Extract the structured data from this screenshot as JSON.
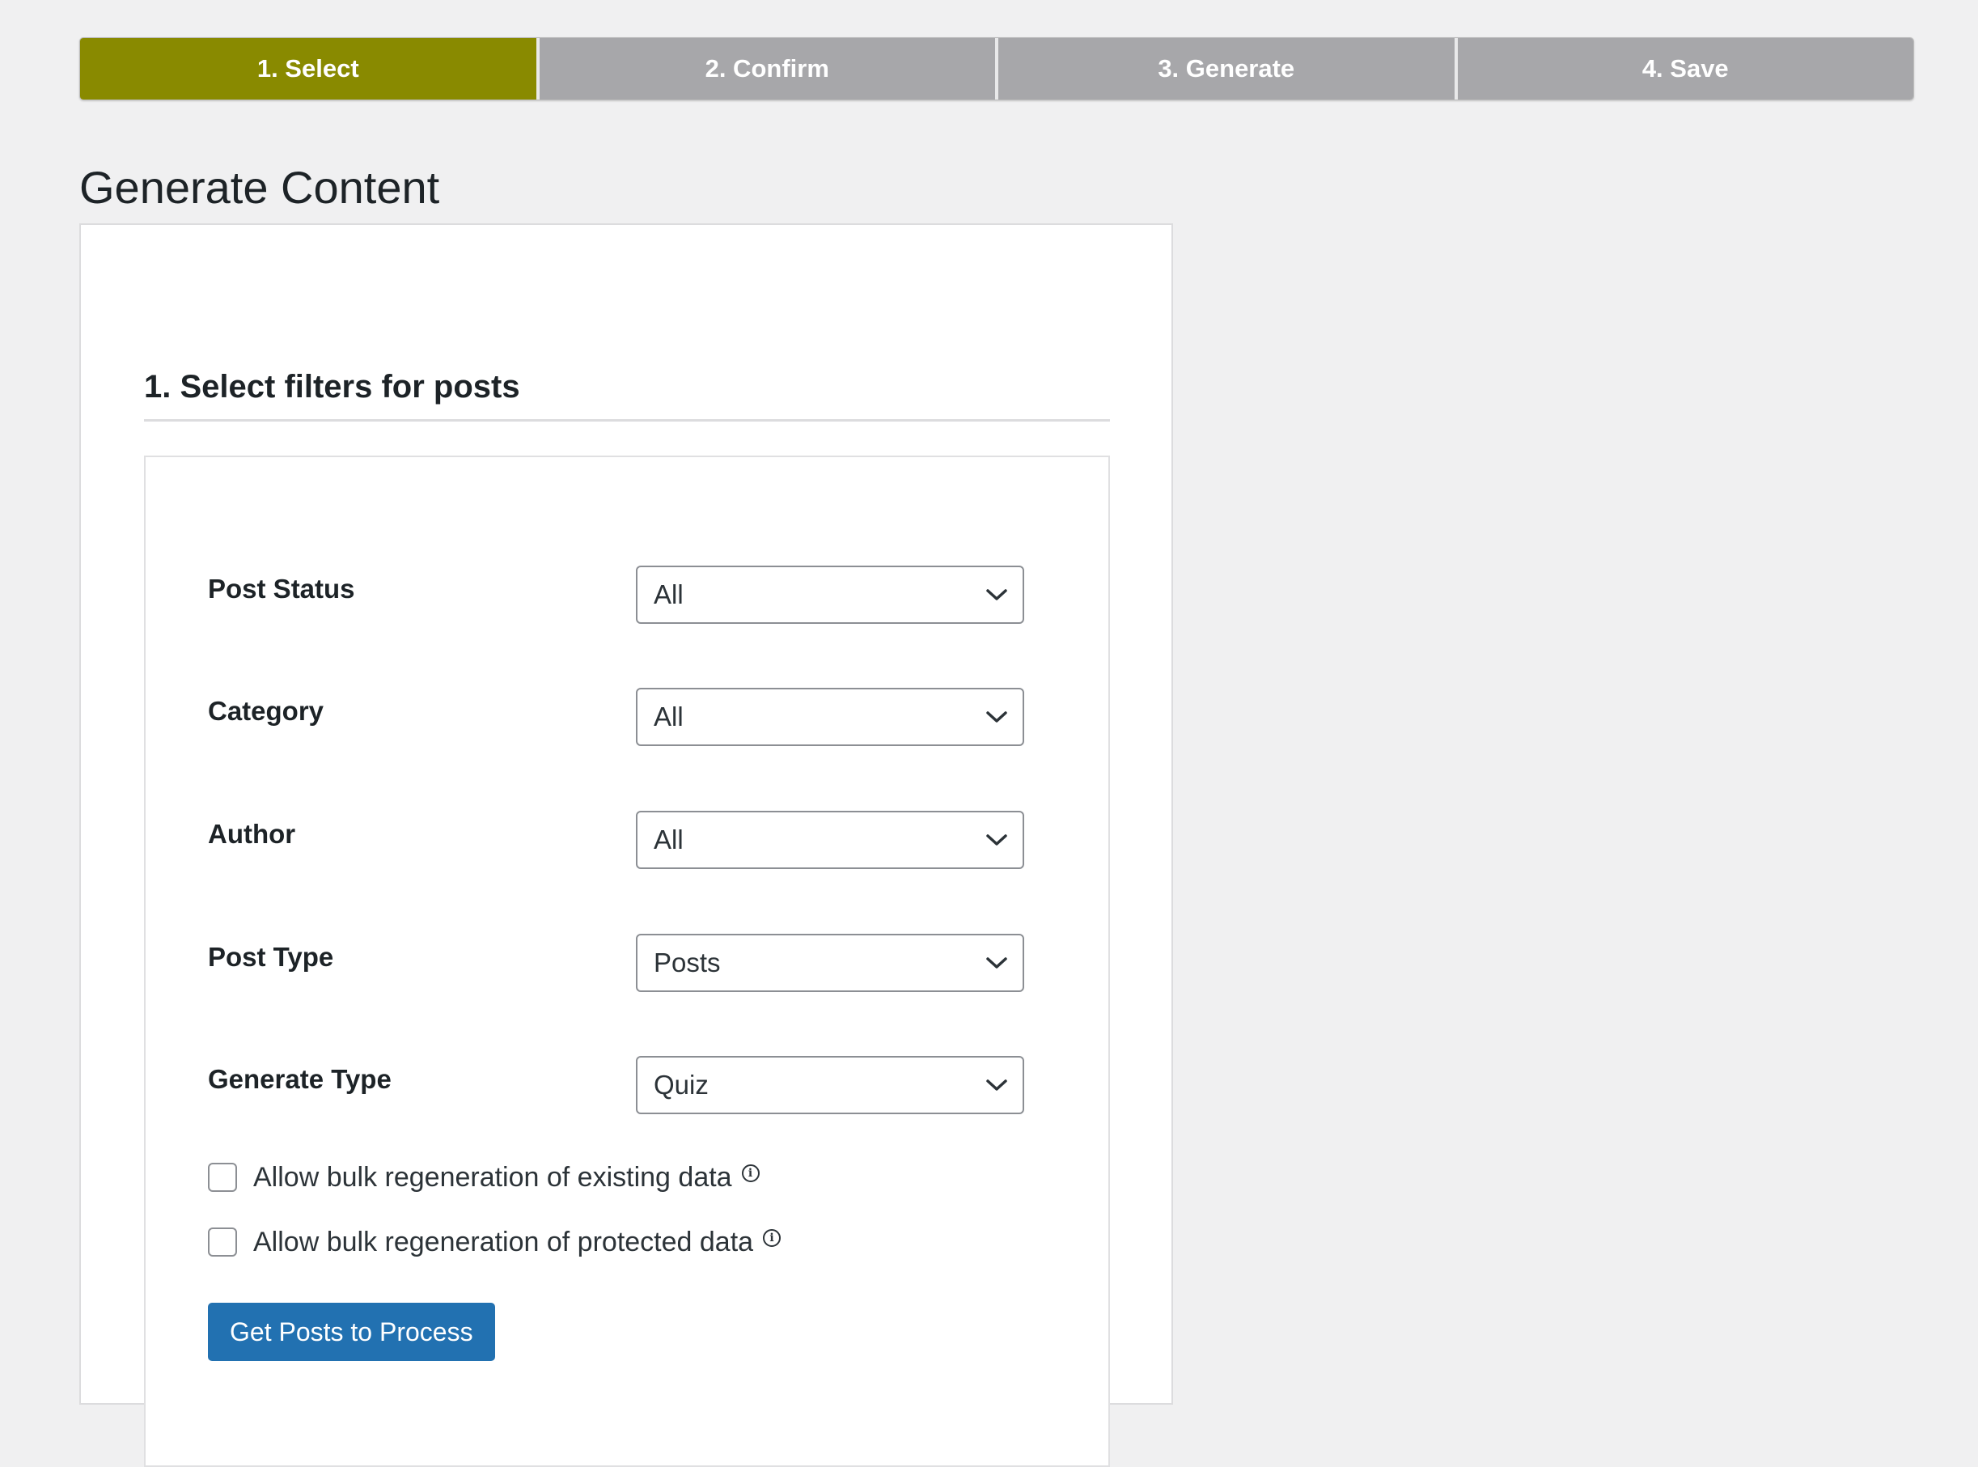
{
  "stepper": {
    "steps": [
      {
        "label": "1. Select",
        "active": true
      },
      {
        "label": "2. Confirm",
        "active": false
      },
      {
        "label": "3. Generate",
        "active": false
      },
      {
        "label": "4. Save",
        "active": false
      }
    ],
    "active_color": "#898a00",
    "inactive_color": "#a7a7aa"
  },
  "page": {
    "title": "Generate Content"
  },
  "filters_section": {
    "title": "1. Select filters for posts",
    "fields": [
      {
        "label": "Post Status",
        "value": "All"
      },
      {
        "label": "Category",
        "value": "All"
      },
      {
        "label": "Author",
        "value": "All"
      },
      {
        "label": "Post Type",
        "value": "Posts"
      },
      {
        "label": "Generate Type",
        "value": "Quiz"
      }
    ],
    "checkboxes": [
      {
        "label": "Allow bulk regeneration of existing data",
        "checked": false,
        "icon": "info-icon"
      },
      {
        "label": "Allow bulk regeneration of protected data",
        "checked": false,
        "icon": "info-icon"
      }
    ],
    "submit_label": "Get Posts to Process",
    "submit_color": "#2271b1"
  }
}
